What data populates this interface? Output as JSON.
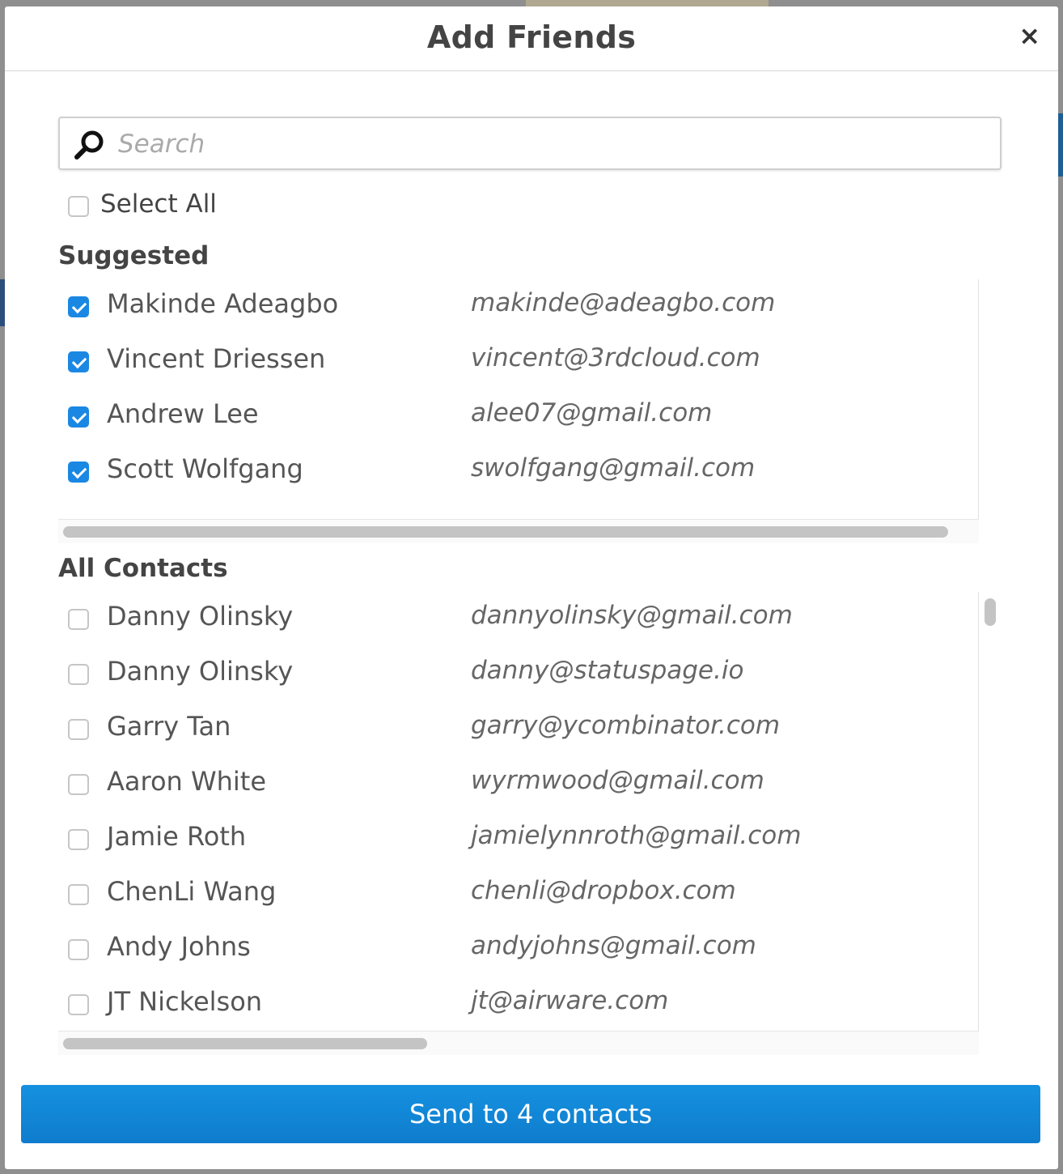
{
  "modal": {
    "title": "Add Friends",
    "close_label": "×"
  },
  "search": {
    "placeholder": "Search",
    "value": ""
  },
  "select_all": {
    "label": "Select All",
    "checked": false
  },
  "suggested": {
    "heading": "Suggested",
    "contacts": [
      {
        "name": "Makinde Adeagbo",
        "email": "makinde@adeagbo.com",
        "checked": true
      },
      {
        "name": "Vincent Driessen",
        "email": "vincent@3rdcloud.com",
        "checked": true
      },
      {
        "name": "Andrew Lee",
        "email": "alee07@gmail.com",
        "checked": true
      },
      {
        "name": "Scott Wolfgang",
        "email": "swolfgang@gmail.com",
        "checked": true
      }
    ]
  },
  "all_contacts": {
    "heading": "All Contacts",
    "contacts": [
      {
        "name": "Danny Olinsky",
        "email": "dannyolinsky@gmail.com",
        "checked": false
      },
      {
        "name": "Danny Olinsky",
        "email": "danny@statuspage.io",
        "checked": false
      },
      {
        "name": "Garry Tan",
        "email": "garry@ycombinator.com",
        "checked": false
      },
      {
        "name": "Aaron White",
        "email": "wyrmwood@gmail.com",
        "checked": false
      },
      {
        "name": "Jamie Roth",
        "email": "jamielynnroth@gmail.com",
        "checked": false
      },
      {
        "name": "ChenLi Wang",
        "email": "chenli@dropbox.com",
        "checked": false
      },
      {
        "name": "Andy Johns",
        "email": "andyjohns@gmail.com",
        "checked": false
      },
      {
        "name": "JT Nickelson",
        "email": "jt@airware.com",
        "checked": false
      }
    ]
  },
  "send_button": {
    "label": "Send to 4 contacts"
  },
  "colors": {
    "accent": "#1a88e3",
    "button": "#1289db"
  }
}
